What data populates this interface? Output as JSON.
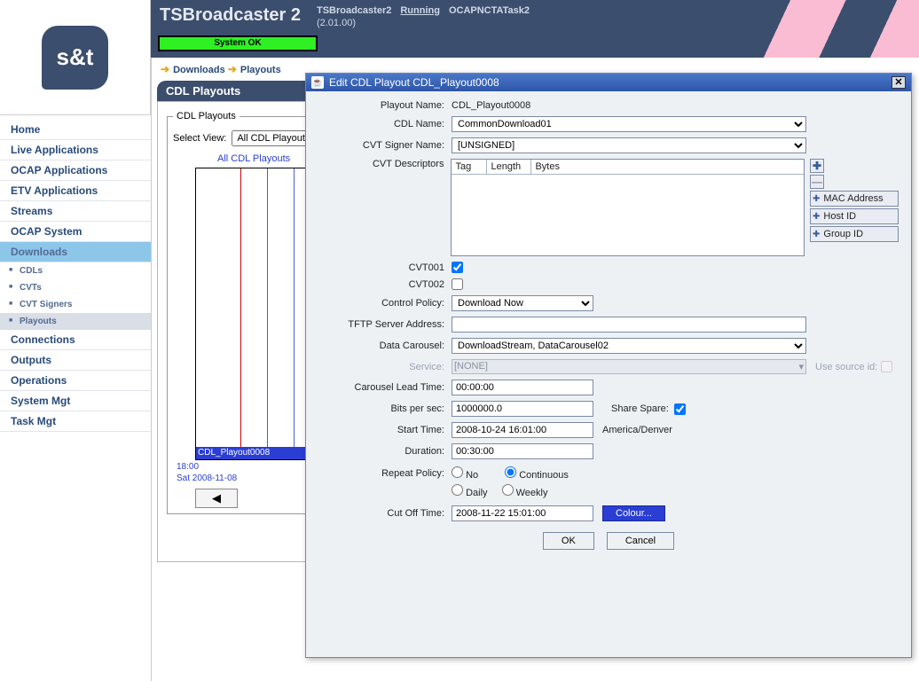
{
  "header": {
    "app_title": "TSBroadcaster 2",
    "instance": "TSBroadcaster2",
    "version": "(2.01.00)",
    "status_link": "Running",
    "task": "OCAPNCTATask2",
    "system_status": "System OK"
  },
  "logo": {
    "text": "s&t"
  },
  "nav": {
    "home": "Home",
    "live_apps": "Live Applications",
    "ocap_apps": "OCAP Applications",
    "etv_apps": "ETV Applications",
    "streams": "Streams",
    "ocap_system": "OCAP System",
    "downloads": "Downloads",
    "cdls": "CDLs",
    "cvts": "CVTs",
    "cvt_signers": "CVT Signers",
    "playouts": "Playouts",
    "connections": "Connections",
    "outputs": "Outputs",
    "operations": "Operations",
    "system_mgt": "System Mgt",
    "task_mgt": "Task Mgt"
  },
  "breadcrumb": {
    "a": "Downloads",
    "b": "Playouts"
  },
  "panel": {
    "title": "CDL Playouts",
    "legend": "CDL Playouts",
    "select_view_label": "Select View:",
    "select_view_value": "All CDL Playouts",
    "chart_title": "All CDL Playouts",
    "selected_item": "CDL_Playout0008",
    "time_label": "18:00",
    "date_label": "Sat 2008-11-08",
    "nav_prev": "◀"
  },
  "dialog": {
    "title": "Edit CDL Playout CDL_Playout0008",
    "labels": {
      "playout_name": "Playout Name:",
      "cdl_name": "CDL Name:",
      "cvt_signer": "CVT Signer Name:",
      "cvt_desc": "CVT Descriptors",
      "tag": "Tag",
      "length": "Length",
      "bytes": "Bytes",
      "mac": "MAC Address",
      "host": "Host ID",
      "group": "Group ID",
      "cvt001": "CVT001",
      "cvt002": "CVT002",
      "control_policy": "Control Policy:",
      "tftp": "TFTP Server Address:",
      "data_carousel": "Data Carousel:",
      "service": "Service:",
      "use_source": "Use source id:",
      "carousel_lead": "Carousel Lead Time:",
      "bits_per_sec": "Bits per sec:",
      "share_spare": "Share Spare:",
      "start_time": "Start Time:",
      "timezone": "America/Denver",
      "duration": "Duration:",
      "repeat_policy": "Repeat Policy:",
      "rp_no": "No",
      "rp_cont": "Continuous",
      "rp_daily": "Daily",
      "rp_weekly": "Weekly",
      "cutoff": "Cut Off Time:",
      "colour": "Colour...",
      "ok": "OK",
      "cancel": "Cancel"
    },
    "values": {
      "playout_name": "CDL_Playout0008",
      "cdl_name": "CommonDownload01",
      "cvt_signer": "[UNSIGNED]",
      "control_policy": "Download Now",
      "tftp": "",
      "data_carousel": "DownloadStream, DataCarousel02",
      "service": "[NONE]",
      "carousel_lead": "00:00:00",
      "bits_per_sec": "1000000.0",
      "start_time": "2008-10-24 16:01:00",
      "duration": "00:30:00",
      "cutoff": "2008-11-22 15:01:00"
    }
  }
}
